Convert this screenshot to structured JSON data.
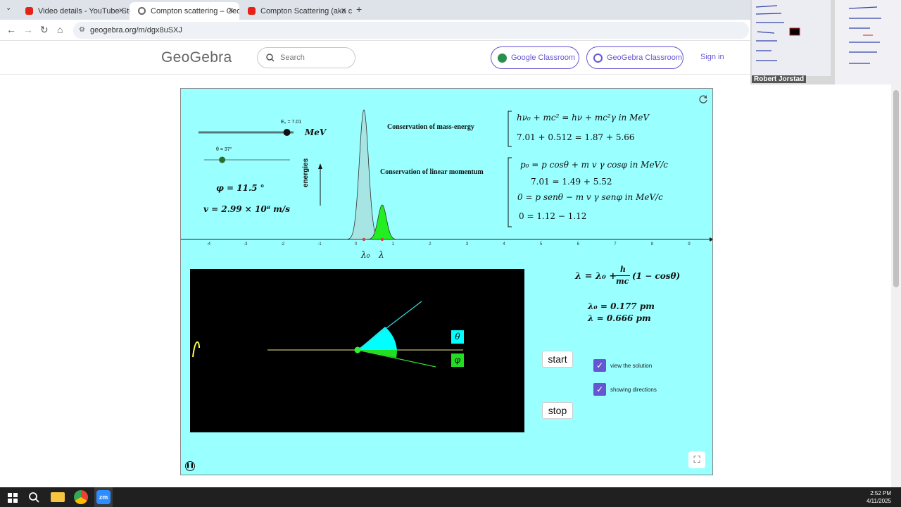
{
  "browser": {
    "tabs": [
      {
        "title": "Video details - YouTube Studio",
        "active": false,
        "favicon_color": "#e62117"
      },
      {
        "title": "Compton scattering – GeoGebr",
        "active": true,
        "favicon_color": "#666666"
      },
      {
        "title": "Compton Scattering (aka c",
        "active": false,
        "favicon_color": "#e62117"
      }
    ],
    "url": "geogebra.org/m/dgx8uSXJ"
  },
  "header": {
    "logo": "GeoGebra",
    "search_placeholder": "Search",
    "google_classroom": "Google Classroom",
    "geogebra_classroom": "GeoGebra Classroom",
    "sign_in": "Sign in"
  },
  "applet": {
    "slider_energy_label": "E₀ = 7.01",
    "energy_unit": "MeV",
    "energy_fraction": 0.93,
    "slider_theta_label": "θ = 37°",
    "theta_fraction": 0.21,
    "phi_text": "φ = 11.5 °",
    "velocity_text": "v = 2.99 × 10⁸ m/s",
    "energies_label": "energies",
    "conservation_mass_energy": "Conservation of mass-energy",
    "conservation_momentum": "Conservation of linear momentum",
    "eq_energy_1": "hν₀ + mc² = hν + mc²γ  in MeV",
    "eq_energy_2": "7.01 + 0.512 = 1.87 + 5.66",
    "eq_mom_1": "p₀ = p cosθ + m v γ cosφ  in MeV/c",
    "eq_mom_2": "7.01 = 1.49 + 5.52",
    "eq_mom_3": "0 = p senθ − m v γ senφ  in MeV/c",
    "eq_mom_4": "0 = 1.12 − 1.12",
    "x_ticks": [
      "-4",
      "-3",
      "-2",
      "-1",
      "0",
      "1",
      "2",
      "3",
      "4",
      "5",
      "6",
      "7",
      "8",
      "9"
    ],
    "lambda0_label": "λ₀",
    "lambda_label": "λ",
    "compton_formula": "λ = λ₀ + h/mc (1 − cosθ)",
    "formula_lhs": "λ = λ₀ +",
    "formula_num": "h",
    "formula_den": "mc",
    "formula_rhs": "(1 − cosθ)",
    "lambda0_value": "λ₀ = 0.177 pm",
    "lambda_value": "λ  =  0.666 pm",
    "theta_box": "θ",
    "phi_box": "φ",
    "start": "start",
    "stop": "stop",
    "view_solution": "view the solution",
    "showing_directions": "showing directions",
    "bg_color": "#99ffff"
  },
  "video": {
    "name": "Robert Jorstad"
  },
  "taskbar": {
    "time": "2:52 PM",
    "date": "4/11/2025"
  }
}
